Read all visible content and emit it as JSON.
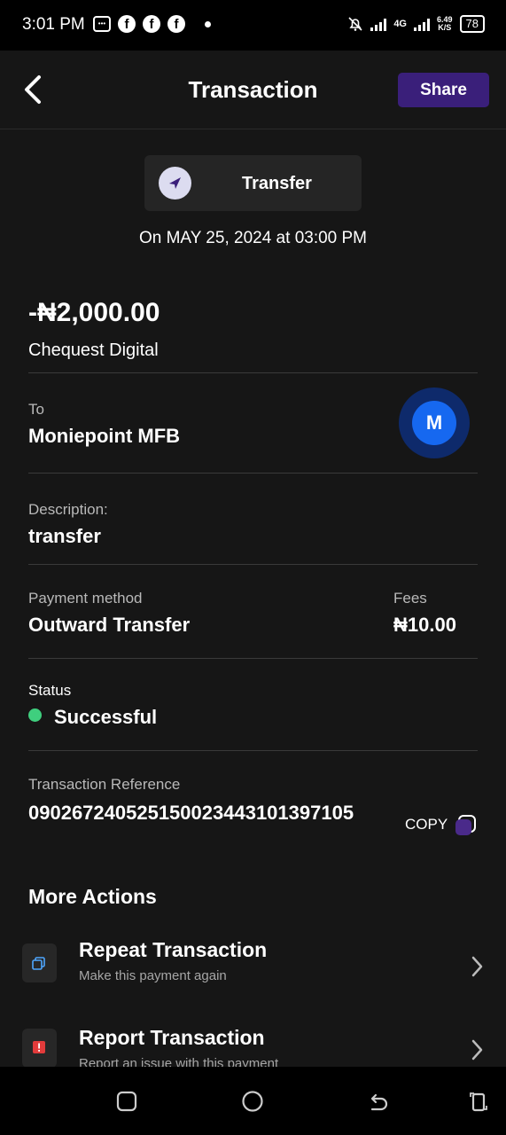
{
  "status_bar": {
    "time": "3:01 PM",
    "network": "4G",
    "speed_value": "6.49",
    "speed_unit": "K/S",
    "battery": "78"
  },
  "header": {
    "title": "Transaction",
    "share_label": "Share"
  },
  "transaction": {
    "type": "Transfer",
    "date_prefix": "On ",
    "date": "MAY 25, 2024",
    "date_mid": " at ",
    "time": "03:00 PM",
    "amount": "-₦2,000.00",
    "counterparty": "Chequest Digital",
    "to_label": "To",
    "to_bank": "Moniepoint MFB",
    "bank_initial": "M",
    "description_label": "Description:",
    "description": "transfer",
    "payment_method_label": "Payment method",
    "payment_method": "Outward Transfer",
    "fees_label": "Fees",
    "fees": "₦10.00",
    "status_label": "Status",
    "status": "Successful",
    "reference_label": "Transaction Reference",
    "reference": "090267240525150023443101397105",
    "copy_label": "COPY"
  },
  "more_actions": {
    "title": "More Actions",
    "items": [
      {
        "title": "Repeat Transaction",
        "subtitle": "Make this payment again",
        "icon": "repeat-icon"
      },
      {
        "title": "Report Transaction",
        "subtitle": "Report an issue with this payment",
        "icon": "report-icon"
      }
    ]
  },
  "colors": {
    "background": "#161616",
    "share_button": "#3a1f7a",
    "success": "#3fcf7e",
    "bank_blue": "#1668f0"
  }
}
